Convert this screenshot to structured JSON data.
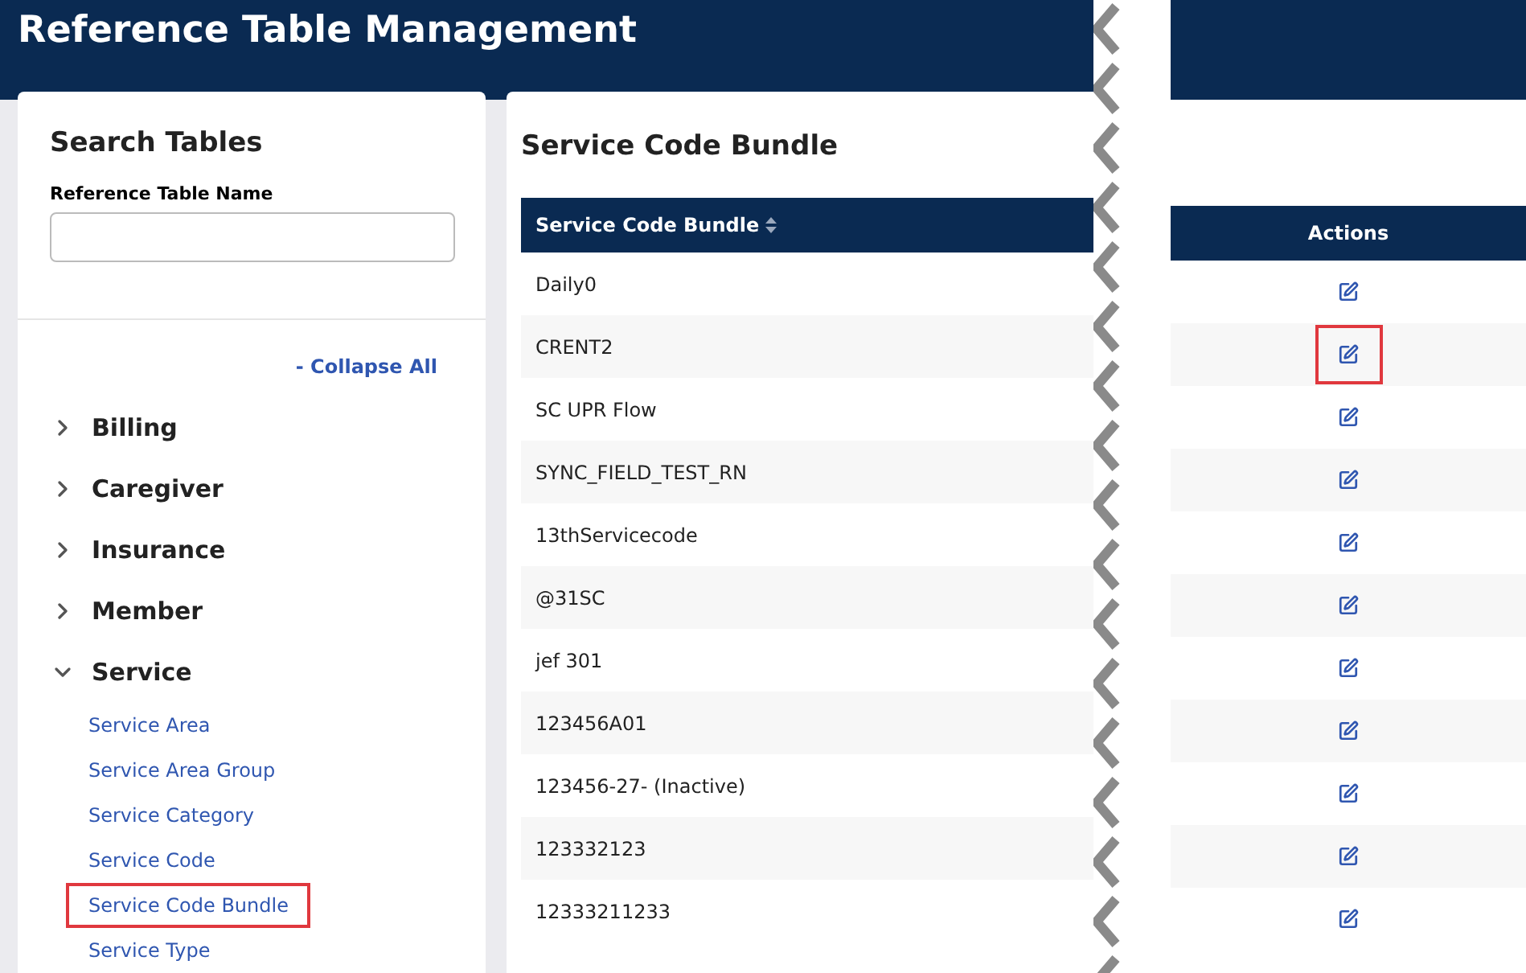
{
  "header": {
    "title": "Reference Table Management"
  },
  "search": {
    "title": "Search Tables",
    "field_label": "Reference Table Name"
  },
  "tree": {
    "collapse_link": "- Collapse All",
    "groups": [
      {
        "label": "Billing",
        "expanded": false
      },
      {
        "label": "Caregiver",
        "expanded": false
      },
      {
        "label": "Insurance",
        "expanded": false
      },
      {
        "label": "Member",
        "expanded": false
      },
      {
        "label": "Service",
        "expanded": true,
        "children": [
          {
            "label": "Service Area",
            "highlighted": false
          },
          {
            "label": "Service Area Group",
            "highlighted": false
          },
          {
            "label": "Service Category",
            "highlighted": false
          },
          {
            "label": "Service Code",
            "highlighted": false
          },
          {
            "label": "Service Code Bundle",
            "highlighted": true
          },
          {
            "label": "Service Type",
            "highlighted": false
          }
        ]
      }
    ]
  },
  "content": {
    "title": "Service Code Bundle",
    "columns": [
      "Service Code Bundle",
      "Actions"
    ],
    "rows": [
      {
        "name": "Daily0",
        "highlighted": false
      },
      {
        "name": "CRENT2",
        "highlighted": true
      },
      {
        "name": "SC UPR Flow",
        "highlighted": false
      },
      {
        "name": "SYNC_FIELD_TEST_RN",
        "highlighted": false
      },
      {
        "name": "13thServicecode",
        "highlighted": false
      },
      {
        "name": "@31SC",
        "highlighted": false
      },
      {
        "name": "jef 301",
        "highlighted": false
      },
      {
        "name": "123456A01",
        "highlighted": false
      },
      {
        "name": "123456-27- (Inactive)",
        "highlighted": false
      },
      {
        "name": "123332123",
        "highlighted": false
      },
      {
        "name": "12333211233",
        "highlighted": false
      }
    ]
  }
}
